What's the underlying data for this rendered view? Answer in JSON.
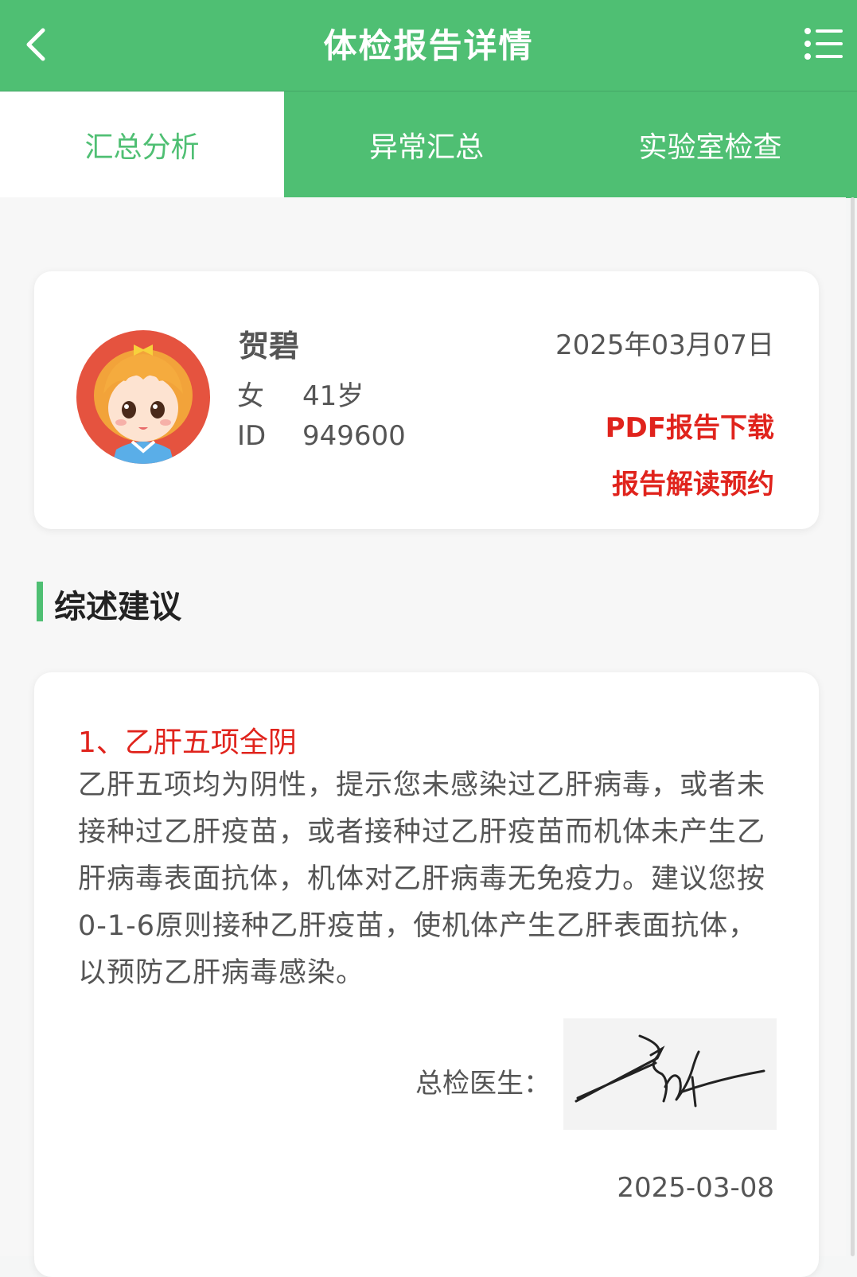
{
  "header": {
    "title": "体检报告详情"
  },
  "tabs": [
    {
      "label": "汇总分析"
    },
    {
      "label": "异常汇总"
    },
    {
      "label": "实验室检查"
    }
  ],
  "profile": {
    "name": "贺碧",
    "gender": "女",
    "age": "41岁",
    "id_label": "ID",
    "id_value": "949600",
    "date": "2025年03月07日",
    "pdf_link": "PDF报告下载",
    "appointment_link": "报告解读预约"
  },
  "section": {
    "title": "综述建议"
  },
  "advice": {
    "title": "1、乙肝五项全阴",
    "body": "乙肝五项均为阴性，提示您未感染过乙肝病毒，或者未接种过乙肝疫苗，或者接种过乙肝疫苗而机体未产生乙肝病毒表面抗体，机体对乙肝病毒无免疫力。建议您按0-1-6原则接种乙肝疫苗，使机体产生乙肝表面抗体，以预防乙肝病毒感染。",
    "doctor_label": "总检医生：",
    "sign_date": "2025-03-08"
  },
  "colors": {
    "brand_green": "#4fbf73",
    "accent_red": "#e0231c"
  }
}
